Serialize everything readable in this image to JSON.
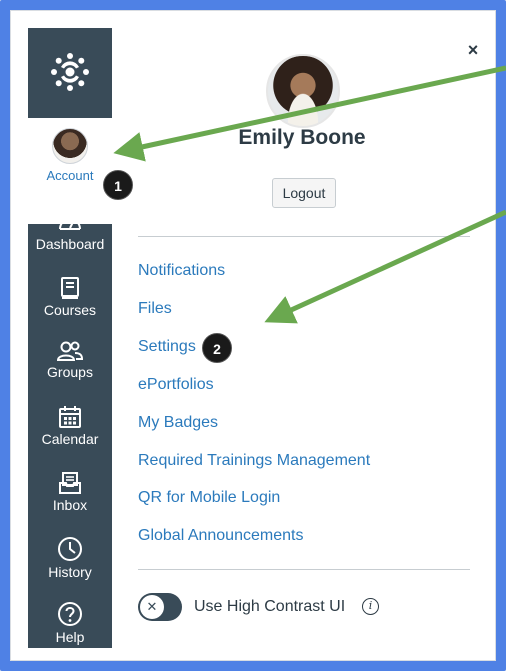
{
  "global_nav": {
    "account_label": "Account",
    "items": [
      {
        "label": "Dashboard",
        "icon": "dashboard-icon"
      },
      {
        "label": "Courses",
        "icon": "courses-icon"
      },
      {
        "label": "Groups",
        "icon": "groups-icon"
      },
      {
        "label": "Calendar",
        "icon": "calendar-icon"
      },
      {
        "label": "Inbox",
        "icon": "inbox-icon"
      },
      {
        "label": "History",
        "icon": "history-icon"
      },
      {
        "label": "Help",
        "icon": "help-icon"
      }
    ]
  },
  "tray": {
    "close_label": "×",
    "user_name": "Emily Boone",
    "logout_label": "Logout",
    "links": [
      "Notifications",
      "Files",
      "Settings",
      "ePortfolios",
      "My Badges",
      "Required Trainings Management",
      "QR for Mobile Login",
      "Global Announcements"
    ],
    "high_contrast": {
      "label": "Use High Contrast UI",
      "toggle_glyph": "✕",
      "info_glyph": "i",
      "enabled": false
    }
  },
  "annotations": {
    "badge_1": "1",
    "badge_2": "2"
  },
  "colors": {
    "frame": "#4f81e5",
    "nav_bg": "#394b58",
    "link": "#2b7abc",
    "arrow": "#6aa84f"
  }
}
